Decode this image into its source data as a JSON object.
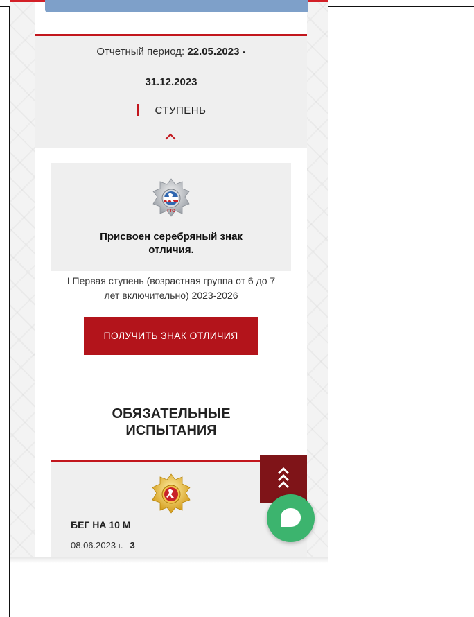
{
  "period": {
    "label": "Отчетный период:",
    "dates_start": "22.05.2023 -",
    "dates_end": "31.12.2023"
  },
  "stage": {
    "label": "СТУПЕНЬ"
  },
  "award": {
    "title_line1": "Присвоен серебряный знак",
    "title_line2": "отличия.",
    "description_line1": "I Первая ступень (возрастная группа от 6 до 7",
    "description_line2": "лет включительно) 2023-2026",
    "button_label": "ПОЛУЧИТЬ ЗНАК ОТЛИЧИЯ",
    "badge_level": "silver"
  },
  "mandatory_tests": {
    "heading_line1": "ОБЯЗАТЕЛЬНЫЕ",
    "heading_line2": "ИСПЫТАНИЯ",
    "items": [
      {
        "name": "БЕГ НА 10 М",
        "date": "08.06.2023 г.",
        "score": "3",
        "badge_level": "gold"
      }
    ]
  },
  "badge_text": "ГТО",
  "colors": {
    "accent_red": "#c2161d",
    "button_red": "#b3141b",
    "scroll_button": "#7f1418",
    "chat_green": "#3cb46e",
    "header_blue": "#7ea0c9"
  },
  "icons": {
    "collapse": "chevron-up-icon",
    "scroll_top": "double-chevron-up-icon",
    "chat": "chat-bubble-icon"
  }
}
